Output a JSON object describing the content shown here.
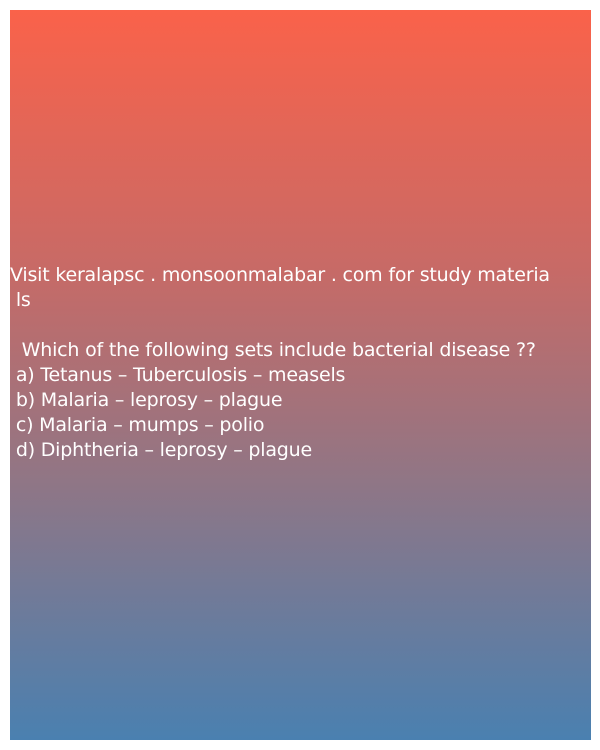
{
  "promo": {
    "line1": "Visit keralapsc . monsoonmalabar . com for study materia",
    "line2": " ls"
  },
  "question": {
    "text": "  Which of the following sets include bacterial disease ??",
    "options": [
      " a) Tetanus – Tuberculosis – measels",
      " b) Malaria – leprosy – plague",
      " c) Malaria – mumps – polio",
      " d) Diphtheria – leprosy – plague"
    ]
  }
}
